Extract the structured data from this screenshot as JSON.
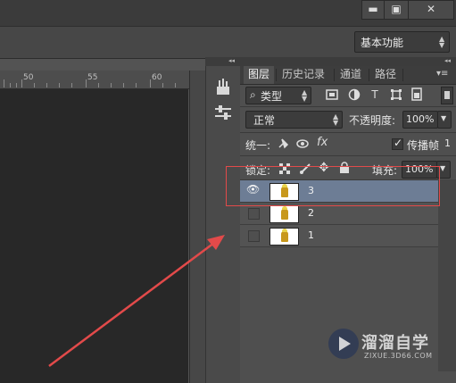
{
  "window": {
    "minimize_icon": "minimize-icon",
    "restore_icon": "restore-icon",
    "close_icon": "close-icon",
    "minimize_glyph": "▬",
    "restore_glyph": "▣",
    "close_glyph": "✕"
  },
  "workspace": {
    "label": "基本功能"
  },
  "ruler": {
    "numbers": [
      "50",
      "55",
      "60"
    ]
  },
  "panel": {
    "tabs": [
      "图层",
      "历史记录",
      "通道",
      "路径"
    ],
    "collapse_glyph": "◂◂",
    "menu_glyph": "▾≡",
    "filter_kind": "类型",
    "blend_mode": "正常",
    "opacity_label": "不透明度:",
    "opacity_value": "100%",
    "unify_label": "统一:",
    "propagate_label": "传播帧",
    "propagate_value": "1",
    "lock_label": "锁定:",
    "fill_label": "填充:",
    "fill_value": "100%"
  },
  "layers": [
    {
      "name": "3",
      "visible": true,
      "selected": true
    },
    {
      "name": "2",
      "visible": false,
      "selected": false
    },
    {
      "name": "1",
      "visible": false,
      "selected": false
    }
  ],
  "watermark": {
    "title": "溜溜自学",
    "url": "ZIXUE.3D66.COM"
  },
  "colors": {
    "selected_layer": "#6d7d95",
    "annotation_red": "#e24a4a",
    "panel_bg": "#4f4f4f"
  }
}
